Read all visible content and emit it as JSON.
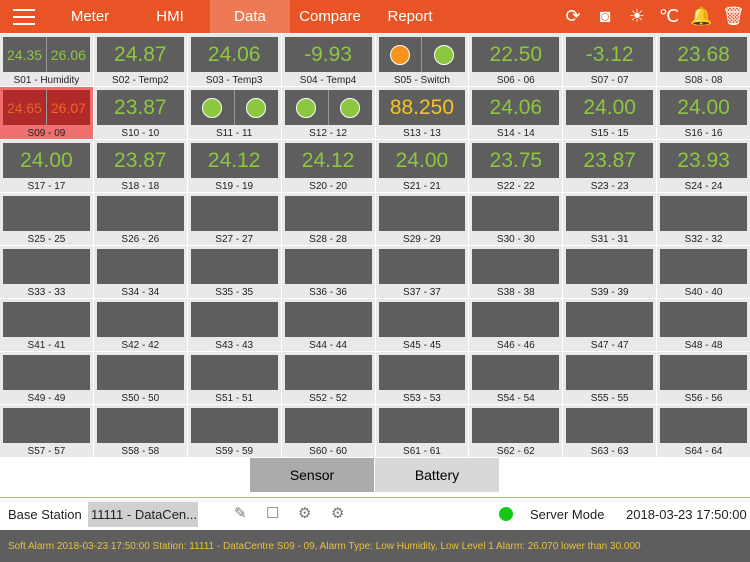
{
  "header": {
    "tabs": [
      "Meter",
      "HMI",
      "Data",
      "Compare",
      "Report"
    ],
    "active": 2,
    "icons": [
      {
        "name": "sync-icon",
        "glyph": "⟳"
      },
      {
        "name": "camera-icon",
        "glyph": "◙"
      },
      {
        "name": "sun-icon",
        "glyph": "☀"
      },
      {
        "name": "celsius-icon",
        "glyph": "℃"
      },
      {
        "name": "alarm-bell-icon",
        "glyph": "🔔"
      },
      {
        "name": "trash-icon",
        "glyph": "🗑"
      }
    ]
  },
  "colors": {
    "green": "#8dc63f",
    "orange": "#f7941d",
    "yellow": "#f5c51e",
    "alarm_text": "#f26522"
  },
  "sensors": [
    {
      "label": "S01 - Humidity",
      "type": "dual",
      "values": [
        "24.35",
        "26.06"
      ]
    },
    {
      "label": "S02 - Temp2",
      "type": "single",
      "value": "24.87"
    },
    {
      "label": "S03 - Temp3",
      "type": "single",
      "value": "24.06"
    },
    {
      "label": "S04 - Temp4",
      "type": "single",
      "value": "-9.93"
    },
    {
      "label": "S05 - Switch",
      "type": "switch",
      "states": [
        "#f7941d",
        "#8dc63f"
      ]
    },
    {
      "label": "S06 - 06",
      "type": "single",
      "value": "22.50"
    },
    {
      "label": "S07 - 07",
      "type": "single",
      "value": "-3.12"
    },
    {
      "label": "S08 - 08",
      "type": "single",
      "value": "23.68"
    },
    {
      "label": "S09 - 09",
      "type": "dual",
      "values": [
        "24.65",
        "26.07"
      ],
      "alarm": true
    },
    {
      "label": "S10 - 10",
      "type": "single",
      "value": "23.87"
    },
    {
      "label": "S11 - 11",
      "type": "switch",
      "states": [
        "#8dc63f",
        "#8dc63f"
      ]
    },
    {
      "label": "S12 - 12",
      "type": "switch",
      "states": [
        "#8dc63f",
        "#8dc63f"
      ]
    },
    {
      "label": "S13 - 13",
      "type": "single",
      "value": "88.250",
      "color": "#f5c51e"
    },
    {
      "label": "S14 - 14",
      "type": "single",
      "value": "24.06"
    },
    {
      "label": "S15 - 15",
      "type": "single",
      "value": "24.00"
    },
    {
      "label": "S16 - 16",
      "type": "single",
      "value": "24.00"
    },
    {
      "label": "S17 - 17",
      "type": "single",
      "value": "24.00"
    },
    {
      "label": "S18 - 18",
      "type": "single",
      "value": "23.87"
    },
    {
      "label": "S19 - 19",
      "type": "single",
      "value": "24.12"
    },
    {
      "label": "S20 - 20",
      "type": "single",
      "value": "24.12"
    },
    {
      "label": "S21 - 21",
      "type": "single",
      "value": "24.00"
    },
    {
      "label": "S22 - 22",
      "type": "single",
      "value": "23.75"
    },
    {
      "label": "S23 - 23",
      "type": "single",
      "value": "23.87"
    },
    {
      "label": "S24 - 24",
      "type": "single",
      "value": "23.93"
    }
  ],
  "empty_sensor_labels": [
    "S25 - 25",
    "S26 - 26",
    "S27 - 27",
    "S28 - 28",
    "S29 - 29",
    "S30 - 30",
    "S31 - 31",
    "S32 - 32",
    "S33 - 33",
    "S34 - 34",
    "S35 - 35",
    "S36 - 36",
    "S37 - 37",
    "S38 - 38",
    "S39 - 39",
    "S40 - 40",
    "S41 - 41",
    "S42 - 42",
    "S43 - 43",
    "S44 - 44",
    "S45 - 45",
    "S46 - 46",
    "S47 - 47",
    "S48 - 48",
    "S49 - 49",
    "S50 - 50",
    "S51 - 51",
    "S52 - 52",
    "S53 - 53",
    "S54 - 54",
    "S55 - 55",
    "S56 - 56",
    "S57 - 57",
    "S58 - 58",
    "S59 - 59",
    "S60 - 60",
    "S61 - 61",
    "S62 - 62",
    "S63 - 63",
    "S64 - 64"
  ],
  "segment": {
    "sensor": "Sensor",
    "battery": "Battery"
  },
  "status": {
    "base_station_label": "Base Station",
    "station": "11111 - DataCen...",
    "mode": "Server Mode",
    "datetime": "2018-03-23 17:50:00"
  },
  "alarm": "Soft Alarm 2018-03-23 17:50:00 Station: 11111 - DataCentre S09 - 09, Alarm Type: Low Humidity, Low Level 1 Alarm: 26.070 lower than 30.000"
}
